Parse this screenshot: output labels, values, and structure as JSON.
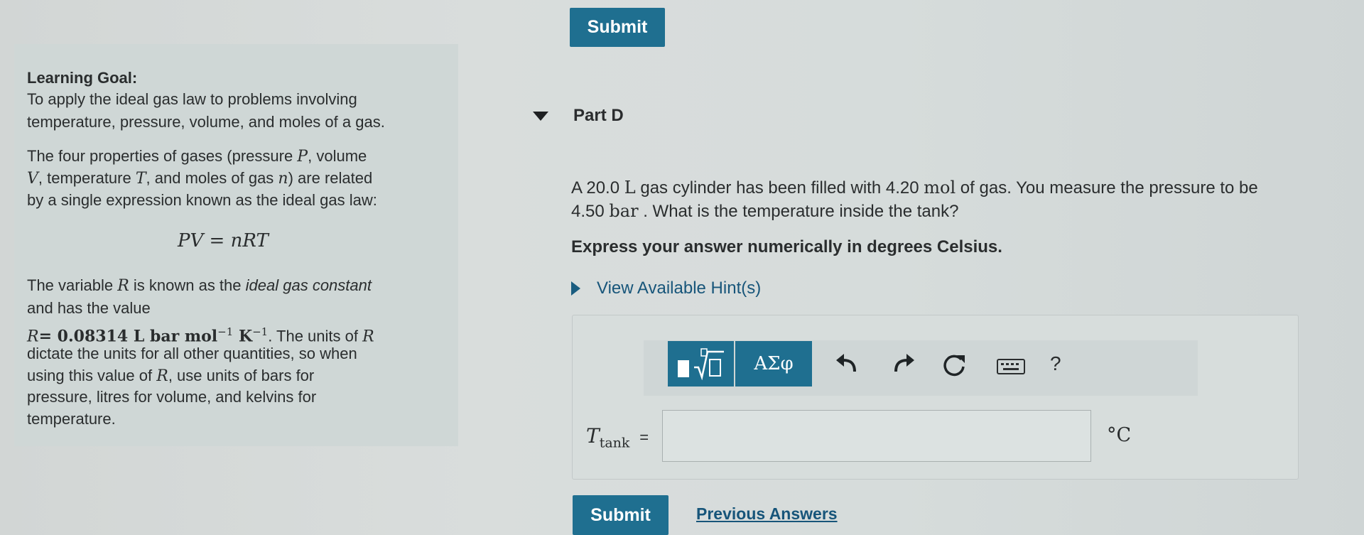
{
  "top_submit_label": "Submit",
  "learning_goal": {
    "heading": "Learning Goal:",
    "goal_line1": "To apply the ideal gas law to problems involving",
    "goal_line2": "temperature, pressure, volume, and moles of a gas.",
    "para1_l1a": "The four properties of gases (pressure ",
    "para1_l1_P": "P",
    "para1_l1b": ", volume",
    "para1_l2_V": "V",
    "para1_l2a": ", temperature ",
    "para1_l2_T": "T",
    "para1_l2b": ", and moles of gas ",
    "para1_l2_n": "n",
    "para1_l2c": ") are related",
    "para1_l3": "by a single expression known as the ideal gas law:",
    "equation": "PV = nRT",
    "para2_l1a": "The variable ",
    "para2_l1_R": "R",
    "para2_l1b": " is known as the ",
    "para2_l1_em": "ideal gas constant",
    "para2_l2": "and has the value",
    "r_value_lhs": "R",
    "r_value_rhs": "= 0.08314 L bar mol",
    "r_exp1": "−1",
    "r_unit_K": " K",
    "r_exp2": "−1",
    "para2_l3a": ". The units of ",
    "para2_l3_R": "R",
    "para2_l4": "dictate the units for all other quantities, so when",
    "para2_l5a": "using this value of ",
    "para2_l5_R": "R",
    "para2_l5b": ", use units of bars for",
    "para2_l6": "pressure, litres for volume, and kelvins for",
    "para2_l7": "temperature."
  },
  "part": {
    "label": "Part D",
    "question_l1a": "A 20.0 ",
    "question_l1_L": "L",
    "question_l1b": " gas cylinder has been filled with 4.20 ",
    "question_l1_mol": "mol",
    "question_l1c": " of gas. You measure the pressure to be",
    "question_l2a": "4.50 ",
    "question_l2_bar": "bar",
    "question_l2b": " . What is the temperature inside the tank?",
    "instruction": "Express your answer numerically in degrees Celsius.",
    "hints_label": "View Available Hint(s)"
  },
  "toolbar": {
    "templates_icon": "templates-icon",
    "symbols_label": "ΑΣφ",
    "undo_icon": "undo-icon",
    "redo_icon": "redo-icon",
    "reset_icon": "reset-icon",
    "keyboard_icon": "keyboard-icon",
    "help_label": "?"
  },
  "answer": {
    "var_main": "T",
    "var_sub": "tank",
    "equals": "=",
    "value": "",
    "unit": "°C"
  },
  "bottom_submit_label": "Submit",
  "previous_answers_label": "Previous Answers",
  "colors": {
    "submit_bg": "#1f6f90",
    "toolbar_bg": "#1f6f90",
    "link": "#17557a",
    "panel_bg": "#cfd7d6"
  }
}
